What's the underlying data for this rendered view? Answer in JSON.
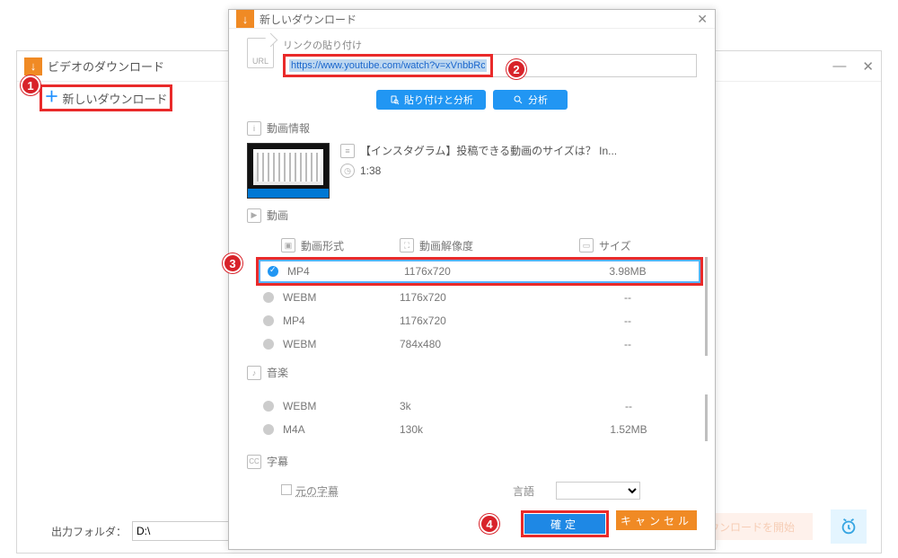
{
  "back": {
    "title": "ビデオのダウンロード",
    "new_download": "新しいダウンロード",
    "out_folder_label": "出力フォルダ：",
    "out_folder_value": "D:\\",
    "ghost_button": "ダウンロードを開始"
  },
  "modal": {
    "title": "新しいダウンロード",
    "url_section": {
      "label": "リンクの貼り付け",
      "value": "https://www.youtube.com/watch?v=xVnbbRcRpbo",
      "icon_text": "URL"
    },
    "buttons": {
      "paste_analyze": "貼り付けと分析",
      "analyze": "分析"
    },
    "info": {
      "section": "動画情報",
      "title": "【インスタグラム】投稿できる動画のサイズは？  In...",
      "duration": "1:38"
    },
    "video": {
      "section": "動画",
      "head_format": "動画形式",
      "head_res": "動画解像度",
      "head_size": "サイズ",
      "rows": [
        {
          "fmt": "MP4",
          "res": "1176x720",
          "size": "3.98MB",
          "selected": true
        },
        {
          "fmt": "WEBM",
          "res": "1176x720",
          "size": "--"
        },
        {
          "fmt": "MP4",
          "res": "1176x720",
          "size": "--"
        },
        {
          "fmt": "WEBM",
          "res": "784x480",
          "size": "--"
        }
      ]
    },
    "audio": {
      "section": "音楽",
      "rows": [
        {
          "fmt": "WEBM",
          "res": "3k",
          "size": "--"
        },
        {
          "fmt": "M4A",
          "res": "130k",
          "size": "1.52MB"
        }
      ]
    },
    "subs": {
      "section": "字幕",
      "orig": "元の字幕",
      "lang_label": "言語"
    },
    "footer": {
      "confirm": "確定",
      "cancel": "キャンセル"
    }
  },
  "badges": {
    "b1": "1",
    "b2": "2",
    "b3": "3",
    "b4": "4"
  }
}
